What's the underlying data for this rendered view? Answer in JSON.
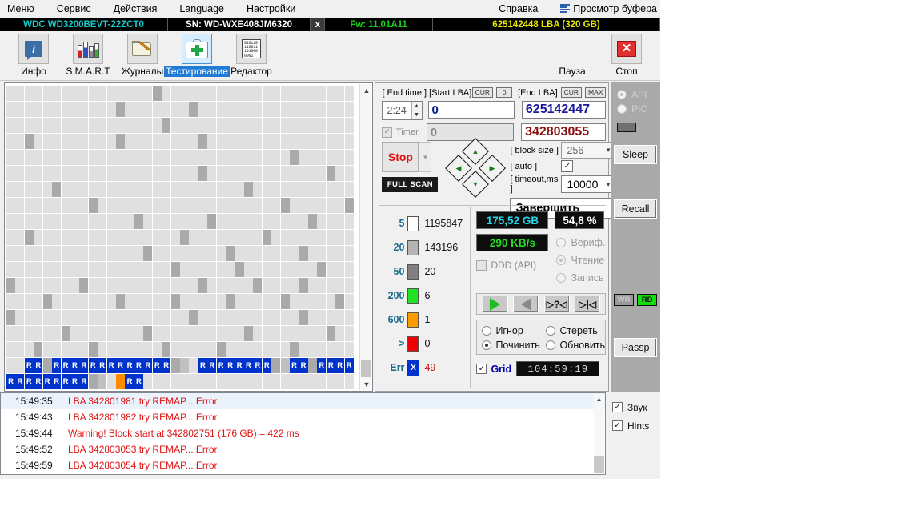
{
  "menu": {
    "items": [
      "Меню",
      "Сервис",
      "Действия",
      "Language",
      "Настройки"
    ],
    "help": "Справка",
    "buffer": "Просмотр буфера"
  },
  "drivebar": {
    "model": "WDC WD3200BEVT-22ZCT0",
    "serial": "SN: WD-WXE408JM6320",
    "close": "x",
    "firmware": "Fw: 11.01A11",
    "capacity": "625142448 LBA (320 GB)"
  },
  "toolbar": {
    "items": [
      {
        "label": "Инфо",
        "icon": "info-icon"
      },
      {
        "label": "S.M.A.R.T",
        "icon": "smart-icon"
      },
      {
        "label": "Журналы",
        "icon": "logs-folder-icon"
      },
      {
        "label": "Тестирование",
        "icon": "test-cross-icon"
      },
      {
        "label": "Редактор",
        "icon": "binary-editor-icon"
      }
    ],
    "pause": "Пауза",
    "stop": "Стоп",
    "binary_icon_text": "010110\n110011\n101000\n0001"
  },
  "controls": {
    "end_time_label": "[ End time ]",
    "end_time_value": "2:24",
    "start_lba_label": "[Start LBA]",
    "start_lba_cur": "CUR",
    "start_lba_zero": "0",
    "start_lba_value": "0",
    "end_lba_label": "[End LBA]",
    "end_lba_cur": "CUR",
    "end_lba_max": "MAX",
    "end_lba_value": "625142447",
    "current_lba_value": "342803055",
    "timer_label": "Timer",
    "timer_value": "0",
    "stop_label": "Stop",
    "full_scan_label": "FULL SCAN",
    "block_size_label": "[ block size ]",
    "block_size_value": "256",
    "auto_label": "[ auto ]",
    "auto_checked": "✓",
    "timeout_label": "[ timeout,ms ]",
    "timeout_value": "10000",
    "action_value": "Завершить"
  },
  "legend": {
    "rows": [
      {
        "threshold": "5",
        "color": "#ffffff",
        "count": "1195847"
      },
      {
        "threshold": "20",
        "color": "#b4b4b4",
        "count": "143196"
      },
      {
        "threshold": "50",
        "color": "#808080",
        "count": "20"
      },
      {
        "threshold": "200",
        "color": "#22e022",
        "count": "6"
      },
      {
        "threshold": "600",
        "color": "#ff9900",
        "count": "1"
      },
      {
        "threshold": ">",
        "color": "#ee0000",
        "count": "0"
      }
    ],
    "err_label": "Err",
    "err_mark": "X",
    "err_count": "49"
  },
  "stats": {
    "size_done": "175,52 GB",
    "percent": "54,8  %",
    "speed": "290 KB/s",
    "ddd_label": "DDD (API)",
    "mode_options": [
      "Вериф.",
      "Чтение",
      "Запись"
    ],
    "mode_selected": "Чтение",
    "transport_buttons": [
      "play-icon",
      "rewind-icon",
      "find-icon",
      "skip-start-icon"
    ],
    "actions": [
      "Игнор",
      "Стереть",
      "Починить",
      "Обновить"
    ],
    "action_selected": "Починить",
    "grid_label": "Grid",
    "elapsed": "104:59:19"
  },
  "sidebar": {
    "api_label": "API",
    "pio_label": "PIO",
    "sleep_label": "Sleep",
    "recall_label": "Recall",
    "wr_label": "WR",
    "rd_label": "RD",
    "passp_label": "Passp"
  },
  "log": {
    "entries": [
      {
        "time": "15:49:35",
        "message": "LBA 342801981 try REMAP... Error",
        "highlight": true
      },
      {
        "time": "15:49:43",
        "message": "LBA 342801982 try REMAP... Error",
        "highlight": false
      },
      {
        "time": "15:49:44",
        "message": "Warning! Block start at 342802751 (176 GB)  = 422 ms",
        "highlight": false
      },
      {
        "time": "15:49:52",
        "message": "LBA 342803053 try REMAP... Error",
        "highlight": false
      },
      {
        "time": "15:49:59",
        "message": "LBA 342803054 try REMAP... Error",
        "highlight": false
      }
    ],
    "sound_label": "Звук",
    "hints_label": "Hints"
  },
  "scan_grid": {
    "cols": 38,
    "rows": 19,
    "colors": {
      "empty": "#e0e0e0",
      "gray": "#aaaaaa",
      "blue": "#0033cc",
      "orange": "#ff8c00",
      "mid": "#c0c0c0"
    },
    "r_letter": "R",
    "rows_data": [
      [
        [
          16,
          "gray"
        ]
      ],
      [
        [
          12,
          "gray"
        ],
        [
          20,
          "gray"
        ]
      ],
      [
        [
          17,
          "gray"
        ]
      ],
      [
        [
          2,
          "gray"
        ],
        [
          12,
          "gray"
        ],
        [
          21,
          "gray"
        ]
      ],
      [
        [
          31,
          "gray"
        ]
      ],
      [
        [
          21,
          "gray"
        ],
        [
          35,
          "gray"
        ]
      ],
      [
        [
          5,
          "gray"
        ],
        [
          26,
          "gray"
        ]
      ],
      [
        [
          9,
          "gray"
        ],
        [
          30,
          "gray"
        ],
        [
          37,
          "gray"
        ]
      ],
      [
        [
          14,
          "gray"
        ],
        [
          22,
          "gray"
        ],
        [
          33,
          "gray"
        ]
      ],
      [
        [
          2,
          "gray"
        ],
        [
          19,
          "gray"
        ],
        [
          28,
          "gray"
        ]
      ],
      [
        [
          15,
          "gray"
        ],
        [
          24,
          "gray"
        ],
        [
          32,
          "gray"
        ]
      ],
      [
        [
          18,
          "gray"
        ],
        [
          25,
          "gray"
        ],
        [
          34,
          "gray"
        ]
      ],
      [
        [
          0,
          "gray"
        ],
        [
          8,
          "gray"
        ],
        [
          21,
          "gray"
        ],
        [
          27,
          "gray"
        ],
        [
          32,
          "gray"
        ]
      ],
      [
        [
          4,
          "gray"
        ],
        [
          12,
          "gray"
        ],
        [
          18,
          "gray"
        ],
        [
          24,
          "gray"
        ],
        [
          30,
          "gray"
        ],
        [
          36,
          "gray"
        ]
      ],
      [
        [
          0,
          "gray"
        ],
        [
          20,
          "gray"
        ],
        [
          32,
          "gray"
        ]
      ],
      [
        [
          6,
          "gray"
        ],
        [
          15,
          "gray"
        ],
        [
          26,
          "gray"
        ],
        [
          35,
          "gray"
        ]
      ],
      [
        [
          3,
          "gray"
        ],
        [
          9,
          "gray"
        ],
        [
          17,
          "gray"
        ],
        [
          23,
          "gray"
        ],
        [
          31,
          "gray"
        ]
      ],
      [
        [
          2,
          "blue"
        ],
        [
          3,
          "blue"
        ],
        [
          4,
          "gray"
        ],
        [
          5,
          "blue"
        ],
        [
          6,
          "blue"
        ],
        [
          7,
          "blue"
        ],
        [
          8,
          "blue"
        ],
        [
          9,
          "blue"
        ],
        [
          10,
          "blue"
        ],
        [
          11,
          "blue"
        ],
        [
          12,
          "blue"
        ],
        [
          13,
          "blue"
        ],
        [
          14,
          "blue"
        ],
        [
          15,
          "blue"
        ],
        [
          16,
          "blue"
        ],
        [
          17,
          "blue"
        ],
        [
          18,
          "gray"
        ],
        [
          19,
          "mid"
        ],
        [
          21,
          "blue"
        ],
        [
          22,
          "blue"
        ],
        [
          23,
          "blue"
        ],
        [
          24,
          "blue"
        ],
        [
          25,
          "blue"
        ],
        [
          26,
          "blue"
        ],
        [
          27,
          "blue"
        ],
        [
          28,
          "blue"
        ],
        [
          29,
          "gray"
        ],
        [
          30,
          "mid"
        ],
        [
          31,
          "blue"
        ],
        [
          32,
          "blue"
        ],
        [
          33,
          "gray"
        ],
        [
          34,
          "blue"
        ],
        [
          35,
          "blue"
        ],
        [
          36,
          "blue"
        ],
        [
          37,
          "blue"
        ]
      ],
      [
        [
          0,
          "blue"
        ],
        [
          1,
          "blue"
        ],
        [
          2,
          "blue"
        ],
        [
          3,
          "blue"
        ],
        [
          4,
          "blue"
        ],
        [
          5,
          "blue"
        ],
        [
          6,
          "blue"
        ],
        [
          7,
          "blue"
        ],
        [
          8,
          "blue"
        ],
        [
          9,
          "gray"
        ],
        [
          10,
          "mid"
        ],
        [
          11,
          "empty"
        ],
        [
          12,
          "orange"
        ],
        [
          13,
          "blue"
        ],
        [
          14,
          "blue"
        ]
      ]
    ]
  }
}
